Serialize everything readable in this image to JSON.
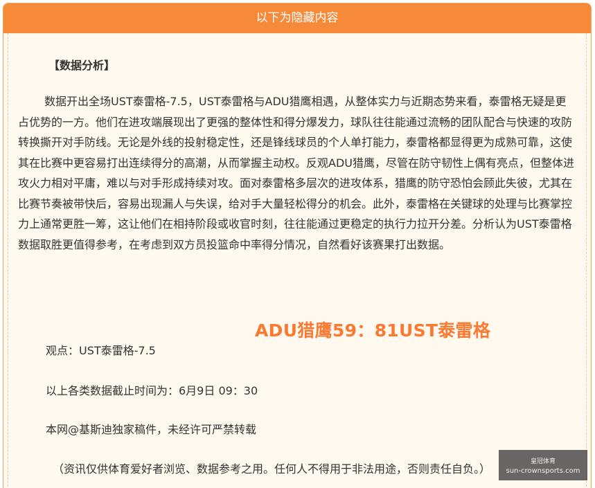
{
  "header": {
    "title": "以下为隐藏内容"
  },
  "content": {
    "section_title": "【数据分析】",
    "analysis": "数据开出全场UST泰雷格-7.5，UST泰雷格与ADU猎鹰相遇，从整体实力与近期态势来看，泰雷格无疑是更占优势的一方。他们在进攻端展现出了更强的整体性和得分爆发力，球队往往能通过流畅的团队配合与快速的攻防转换撕开对手防线。无论是外线的投射稳定性，还是锋线球员的个人单打能力，泰雷格都显得更为成熟可靠，这使其在比赛中更容易打出连续得分的高潮，从而掌握主动权。反观ADU猎鹰，尽管在防守韧性上偶有亮点，但整体进攻火力相对平庸，难以与对手形成持续对攻。面对泰雷格多层次的进攻体系，猎鹰的防守恐怕会顾此失彼，尤其在比赛节奏被带快后，容易出现漏人与失误，给对手大量轻松得分的机会。此外，泰雷格在关键球的处理与比赛掌控力上通常更胜一筹，这让他们在相持阶段或收官时刻，往往能通过更稳定的执行力拉开分差。分析认为UST泰雷格数据取胜更值得参考，在考虑到双方员投篮命中率得分情况，自然看好该赛果打出数据。",
    "score": "ADU猎鹰59：81UST泰雷格",
    "viewpoint": "观点：UST泰雷格-7.5",
    "cutoff": "以上各类数据截止时间为：6月9日 09：30",
    "copyright": "本网@基斯迪独家稿件，未经许可严禁转载",
    "disclaimer": "（资讯仅供体育爱好者浏览、数据参考之用。任何人不得用于非法用途，否则责任自负。）"
  },
  "watermark": {
    "top": "皇冠体育",
    "url": "sun-crownsports.com"
  },
  "colors": {
    "header_bg": "#f78a38",
    "panel_bg": "#fff9ef",
    "score": "#fb7a33"
  }
}
